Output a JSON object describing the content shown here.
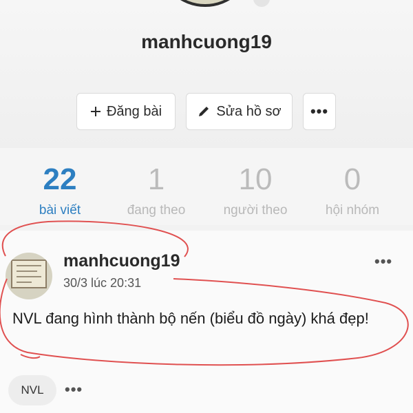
{
  "profile": {
    "username": "manhcuong19",
    "buttons": {
      "post_label": "Đăng bài",
      "edit_label": "Sửa hồ sơ",
      "more_label": "•••"
    }
  },
  "stats": [
    {
      "value": "22",
      "label": "bài viết"
    },
    {
      "value": "1",
      "label": "đang theo"
    },
    {
      "value": "10",
      "label": "người theo"
    },
    {
      "value": "0",
      "label": "hội nhóm"
    }
  ],
  "post": {
    "author": "manhcuong19",
    "timestamp": "30/3 lúc 20:31",
    "menu_label": "•••",
    "text": "NVL đang hình thành bộ nến (biểu đồ ngày) khá đẹp!",
    "tag": "NVL",
    "tag_more": "•••"
  },
  "colors": {
    "accent": "#2d7fc1",
    "annotation": "#e05050"
  }
}
